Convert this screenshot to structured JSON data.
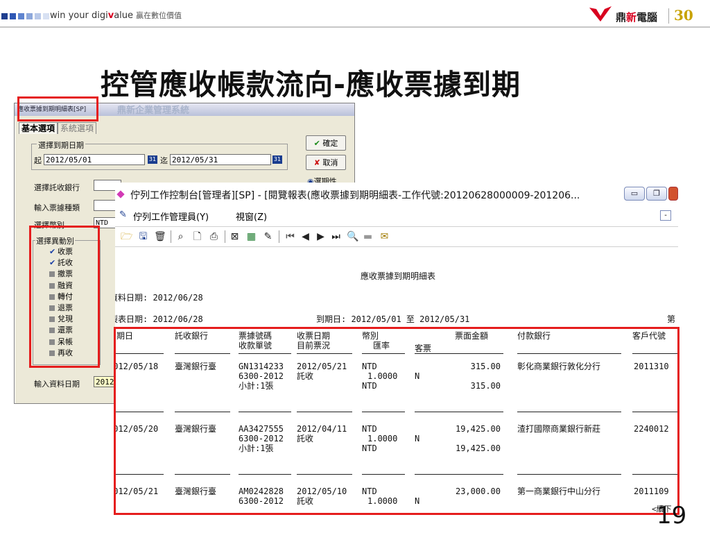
{
  "header": {
    "brand_prefix": "win your digi",
    "brand_v": "v",
    "brand_suffix": "alue",
    "brand_chinese": "贏在數位價值",
    "logo_name_a": "鼎",
    "logo_name_b": "新",
    "logo_name_c": "電腦",
    "logo_30": "30",
    "block_colors": [
      "#1f3f8f",
      "#2e57b4",
      "#5f84cf",
      "#8ea8db",
      "#b9c9e9",
      "#d8e1f3"
    ]
  },
  "slide": {
    "title": "控管應收帳款流向-應收票據到期",
    "page_number": "19"
  },
  "dialog": {
    "title": "應收票據到期明細表[SP]",
    "ghost_title": "鼎新企業管理系統",
    "tab_basic": "基本選項",
    "tab_system": "系統選項",
    "group_due_date": "選擇到期日期",
    "from_label": "起",
    "from_value": "2012/05/01",
    "to_label": "迄",
    "to_value": "2012/05/31",
    "cal_icon": "31",
    "confirm_label": "確定",
    "cancel_label": "取消",
    "param_label": "選期性",
    "bank_label": "選擇託收銀行",
    "bill_type_label": "輸入票據種類",
    "currency_label": "選擇幣別",
    "currency_value": "NTD",
    "change_group_label": "選擇異動別",
    "change_items": [
      {
        "label": "收票",
        "checked": true
      },
      {
        "label": "託收",
        "checked": true
      },
      {
        "label": "撤票",
        "checked": false
      },
      {
        "label": "融資",
        "checked": false
      },
      {
        "label": "轉付",
        "checked": false
      },
      {
        "label": "退票",
        "checked": false
      },
      {
        "label": "兌現",
        "checked": false
      },
      {
        "label": "還票",
        "checked": false
      },
      {
        "label": "呆帳",
        "checked": false
      },
      {
        "label": "再收",
        "checked": false
      }
    ],
    "input_date_label": "輸入資料日期",
    "input_date_value": "2012"
  },
  "window": {
    "title": "佇列工作控制台[管理者][SP] - [閱覽報表(應收票據到期明細表-工作代號:20120628000009-201206...",
    "menu_queue": "佇列工作管理員(Y)",
    "menu_window": "視窗(Z)",
    "minimize": "▭",
    "restore": "❐",
    "inner_min": "-"
  },
  "report": {
    "title": "應收票據到期明細表",
    "data_date": "資料日期: 2012/06/28",
    "print_date": "製表日期: 2012/06/28",
    "due_range": "到期日: 2012/05/01 至 2012/05/31",
    "page_prefix": "第",
    "headers": {
      "due_date": "到期日",
      "bank": "託收銀行",
      "bill_no_1": "票據號碼",
      "bill_no_2": "收款單號",
      "recv_date_1": "收票日期",
      "recv_date_2": "目前票況",
      "currency_1": "幣別",
      "currency_2": "匯率",
      "customer_bill": "客票",
      "amount": "票面金額",
      "pay_bank": "付款銀行",
      "customer_code": "客戶代號"
    },
    "rows": [
      {
        "due_date": "2012/05/18",
        "bank": "臺灣銀行臺",
        "bill_no": "GN1314233",
        "receipt_no": "6300-2012",
        "subtotal": "小計:1張",
        "recv_date": "2012/05/21",
        "status": "託收",
        "currency": "NTD",
        "rate": "1.0000",
        "sub_currency": "NTD",
        "customer_bill": "N",
        "amount": "315.00",
        "sub_amount": "315.00",
        "pay_bank": "彰化商業銀行敦化分行",
        "customer_code": "2011310"
      },
      {
        "due_date": "2012/05/20",
        "bank": "臺灣銀行臺",
        "bill_no": "AA3427555",
        "receipt_no": "6300-2012",
        "subtotal": "小計:1張",
        "recv_date": "2012/04/11",
        "status": "託收",
        "currency": "NTD",
        "rate": "1.0000",
        "sub_currency": "NTD",
        "customer_bill": "N",
        "amount": "19,425.00",
        "sub_amount": "19,425.00",
        "pay_bank": "渣打國際商業銀行新莊",
        "customer_code": "2240012"
      },
      {
        "due_date": "2012/05/21",
        "bank": "臺灣銀行臺",
        "bill_no": "AM0242828",
        "receipt_no": "6300-2012",
        "subtotal": "",
        "recv_date": "2012/05/10",
        "status": "託收",
        "currency": "NTD",
        "rate": "1.0000",
        "sub_currency": "",
        "customer_bill": "N",
        "amount": "23,000.00",
        "sub_amount": "",
        "pay_bank": "第一商業銀行中山分行",
        "customer_code": "2011109"
      }
    ],
    "continued": "<續下"
  }
}
